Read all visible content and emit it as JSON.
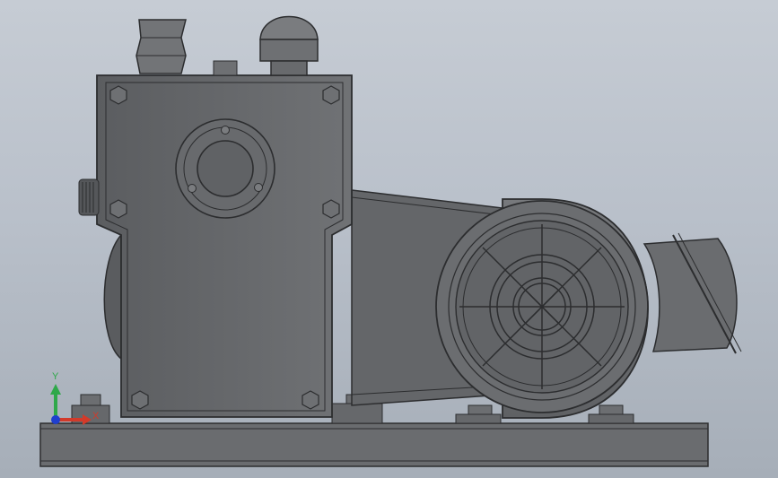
{
  "viewport": {
    "background_top": "#c6ccd4",
    "background_bottom": "#a6aeb8",
    "model_color": "#6d6f72",
    "edge_color": "#2c2d2f"
  },
  "triad": {
    "y_label": "Y",
    "x_label": "X",
    "y_color": "#2fa84a",
    "x_color": "#d23a2a",
    "origin_color": "#1f3fcf"
  }
}
